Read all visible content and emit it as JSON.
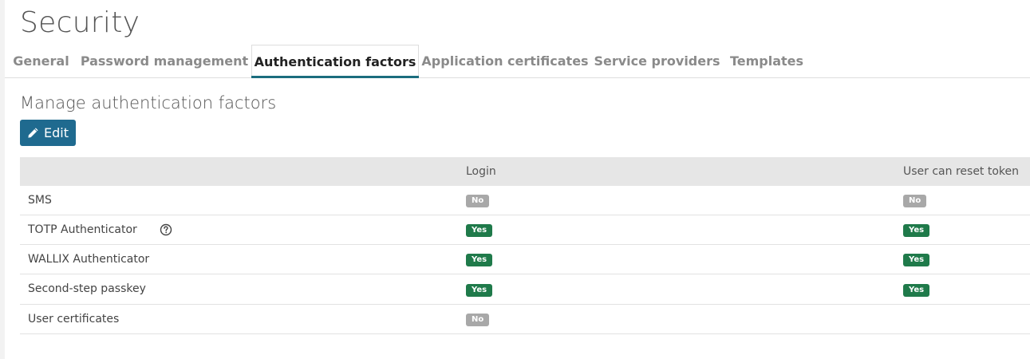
{
  "page": {
    "title": "Security"
  },
  "tabs": [
    {
      "label": "General"
    },
    {
      "label": "Password management"
    },
    {
      "label": "Authentication factors",
      "active": true
    },
    {
      "label": "Application certificates"
    },
    {
      "label": "Service providers"
    },
    {
      "label": "Templates"
    }
  ],
  "section": {
    "title": "Manage authentication factors",
    "edit_label": "Edit"
  },
  "table": {
    "headers": [
      "",
      "Login",
      "User can reset token"
    ],
    "rows": [
      {
        "label": "SMS",
        "login": "No",
        "reset": "No"
      },
      {
        "label": "TOTP Authenticator",
        "login": "Yes",
        "reset": "Yes",
        "help_icon": "question-circle-icon"
      },
      {
        "label": "WALLIX Authenticator",
        "login": "Yes",
        "reset": "Yes"
      },
      {
        "label": "Second-step passkey",
        "login": "Yes",
        "reset": "Yes"
      },
      {
        "label": "User certificates",
        "login": "No",
        "reset": null
      }
    ]
  },
  "colors": {
    "accent": "#1b6d7e",
    "button": "#1f6a8f",
    "yes_badge": "#1f7a4a",
    "no_badge": "#a8a8a8"
  }
}
